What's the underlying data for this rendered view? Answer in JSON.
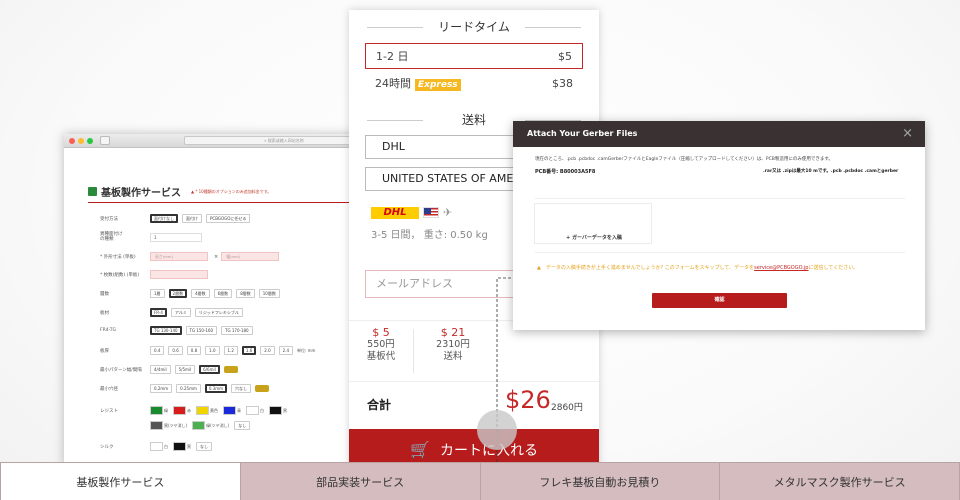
{
  "browser": {
    "url_placeholder": "搜索或输入网站名称"
  },
  "form": {
    "title": "基板製作サービス",
    "notice": "▲ * 10種類のオプションのみ追加料金です。",
    "rows": [
      {
        "label": "受付方法",
        "options": [
          "面付けなし",
          "面付け",
          "PCBGOGOに任せる"
        ]
      },
      {
        "label": "異種面付け\nの種類",
        "value": "1"
      },
      {
        "label": "* 外形寸法 (単板)",
        "placeholders": [
          "長さ(mm)",
          "幅(mm)"
        ]
      },
      {
        "label": "* 枚数(組数) (単板)"
      },
      {
        "label": "層数",
        "options": [
          "1層",
          "2層数",
          "4層数",
          "6層数",
          "8層数",
          "10層数"
        ]
      },
      {
        "label": "板材",
        "options": [
          "FR-4",
          "アルミ",
          "リジッドフレキシブル"
        ]
      },
      {
        "label": "FR4-TG",
        "options": [
          "TG 130-140",
          "TG 150-160",
          "TG 170-180"
        ]
      },
      {
        "label": "板厚",
        "options": [
          "0.4",
          "0.6",
          "0.8",
          "1.0",
          "1.2",
          "1.6",
          "2.0",
          "2.4"
        ],
        "unit": "単位: mm"
      },
      {
        "label": "最小パターン幅/間隔",
        "options": [
          "4/4mil",
          "5/5mil",
          "6/6mil"
        ]
      },
      {
        "label": "最小穴径",
        "options": [
          "0.2mm",
          "0.25mm",
          "0.3mm",
          "穴なし"
        ]
      },
      {
        "label": "レジスト",
        "colors": [
          {
            "label": "緑",
            "hex": "#1a8a2e"
          },
          {
            "label": "赤",
            "hex": "#d81c1c"
          },
          {
            "label": "黄色",
            "hex": "#f0d400"
          },
          {
            "label": "青",
            "hex": "#1a2ad8"
          },
          {
            "label": "白",
            "hex": "#ffffff"
          },
          {
            "label": "黒",
            "hex": "#111111"
          }
        ],
        "extra": [
          "黒(ツヤ消し)",
          "緑(ツヤ消し)",
          "なし"
        ]
      },
      {
        "label": "シルク",
        "colors": [
          {
            "label": "白",
            "hex": "#ffffff"
          },
          {
            "label": "黒",
            "hex": "#111111"
          }
        ],
        "extra": [
          "なし"
        ]
      }
    ]
  },
  "order": {
    "lead_time_title": "リードタイム",
    "lead_times": [
      {
        "label": "1-2 日",
        "price": "$5"
      },
      {
        "label": "24時間",
        "badge": "Express",
        "price": "$38"
      }
    ],
    "shipping_title": "送料",
    "carrier": "DHL",
    "country": "UNITED STATES OF AMERICA",
    "carrier_logo": "DHL",
    "ship_info": "3-5 日間， 重さ: 0.50 kg",
    "email_placeholder": "メールアドレス",
    "prices": [
      {
        "usd": "$ 5",
        "jpy": "550円",
        "label": "基板代"
      },
      {
        "usd": "$ 21",
        "jpy": "2310円",
        "label": "送料"
      }
    ],
    "total_label": "合計",
    "total_usd": "$26",
    "total_jpy": "2860円",
    "cart_label": "カートに入れる"
  },
  "dialog": {
    "title": "Attach Your Gerber Files",
    "close": "×",
    "intro": "現在のところ、.pcb .pcbdoc .camGerberファイルとEagleファイル（圧縮してアップロードしてください）は、PCB製造用にのみ使用できます。",
    "pcb_label": "PCB番号: B80003A5F8",
    "size_note": ".rar又は .zipは最大10 mです。.pcb .pcbdoc .camとgerber",
    "dropzone_label": "+ ガーバーデータを入稿",
    "warn_text": "▲　データの入稿手続きが上手く進めませんでしょうか? このフォームをスキップして、データを",
    "warn_link": "service@PCBGOGO.jp",
    "warn_tail": "に送信してください。",
    "confirm": "確認"
  },
  "tabs": [
    "基板製作サービス",
    "部品実装サービス",
    "フレキ基板自動お見積り",
    "メタルマスク製作サービス"
  ],
  "colors": {
    "accent": "#b71c1c",
    "express": "#f6b820",
    "tab_bg": "#d4bcbf",
    "dialog_head": "#3a3232"
  }
}
